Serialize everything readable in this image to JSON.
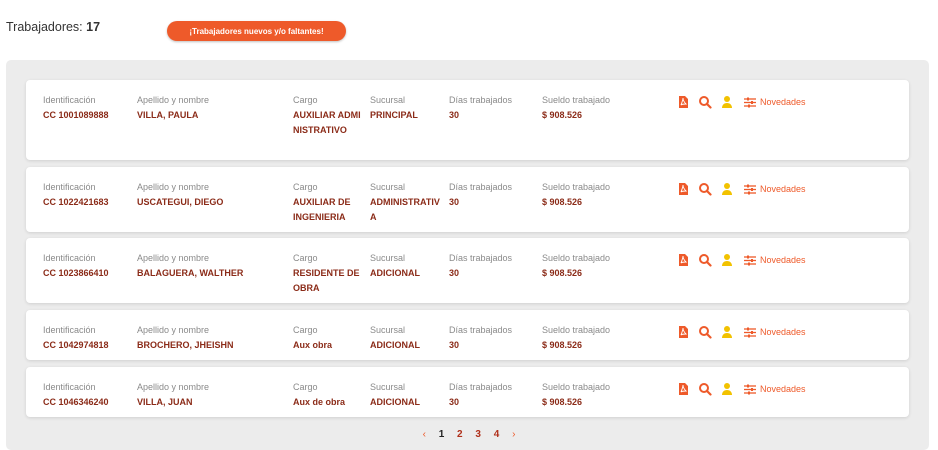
{
  "header": {
    "count_label": "Trabajadores:",
    "count_value": "17",
    "alert_button": "¡Trabajadores nuevos y/o faltantes!"
  },
  "labels": {
    "id": "Identificación",
    "name": "Apellido y nombre",
    "cargo": "Cargo",
    "sucursal": "Sucursal",
    "dias": "Días trabajados",
    "sueldo": "Sueldo trabajado",
    "novedades": "Novedades"
  },
  "workers": [
    {
      "id": "CC 1001089888",
      "name": "VILLA, PAULA",
      "cargo": "AUXILIAR ADMINISTRATIVO",
      "sucursal": "PRINCIPAL",
      "dias": "30",
      "sueldo": "$ 908.526"
    },
    {
      "id": "CC 1022421683",
      "name": "USCATEGUI, DIEGO",
      "cargo": "AUXILIAR DE INGENIERIA",
      "sucursal": "ADMINISTRATIVA",
      "dias": "30",
      "sueldo": "$ 908.526"
    },
    {
      "id": "CC 1023866410",
      "name": "BALAGUERA, WALTHER",
      "cargo": "RESIDENTE DE OBRA",
      "sucursal": "ADICIONAL",
      "dias": "30",
      "sueldo": "$ 908.526"
    },
    {
      "id": "CC 1042974818",
      "name": "BROCHERO, JHEISHN",
      "cargo": "Aux obra",
      "sucursal": "ADICIONAL",
      "dias": "30",
      "sueldo": "$ 908.526"
    },
    {
      "id": "CC 1046346240",
      "name": "VILLA, JUAN",
      "cargo": "Aux de obra",
      "sucursal": "ADICIONAL",
      "dias": "30",
      "sueldo": "$ 908.526"
    }
  ],
  "pagination": {
    "prev": "‹",
    "pages": [
      "1",
      "2",
      "3",
      "4"
    ],
    "current": "1",
    "next": "›"
  },
  "colors": {
    "accent": "#ee5a2a",
    "value": "#8b2b18",
    "user_icon": "#f2c200"
  },
  "icons": [
    "pdf-icon",
    "search-icon",
    "user-icon",
    "sliders-icon"
  ]
}
